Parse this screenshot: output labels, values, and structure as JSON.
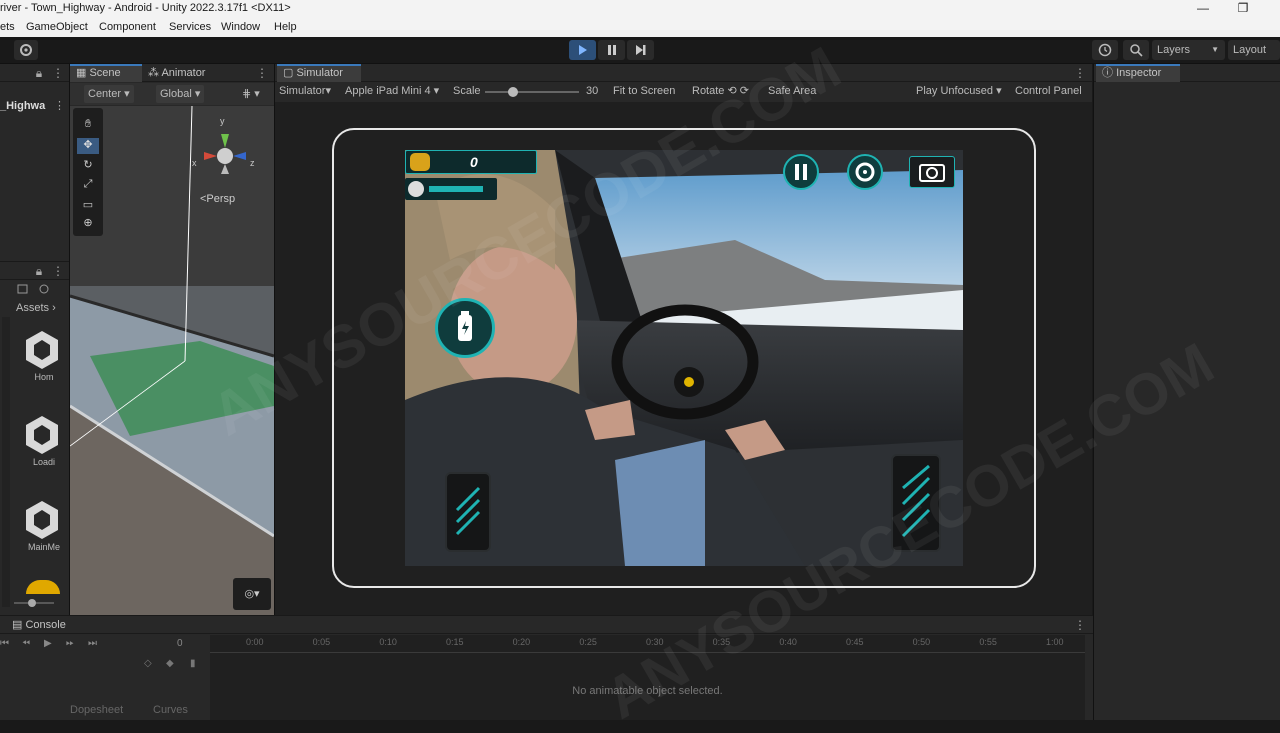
{
  "window": {
    "title": "river - Town_Highway - Android - Unity 2022.3.17f1 <DX11>",
    "minimize_glyph": "—",
    "maximize_glyph": "❐"
  },
  "menu": [
    "ets",
    "GameObject",
    "Component",
    "Services",
    "Window",
    "Help"
  ],
  "toolbar": {
    "layers_label": "Layers",
    "layout_label": "Layout",
    "icons": [
      "gear-icon",
      "play-icon",
      "pause-icon",
      "step-icon",
      "history-icon",
      "search-icon"
    ]
  },
  "hierarchy": {
    "scene_name": "_Highwa"
  },
  "project": {
    "breadcrumb": "Assets",
    "items": [
      {
        "label": "Hom"
      },
      {
        "label": "Loadi"
      },
      {
        "label": "MainMe"
      }
    ]
  },
  "scene_view": {
    "tabs": [
      "Scene",
      "Animator"
    ],
    "pivot_label": "Center",
    "space_label": "Global",
    "persp_label": "<Persp",
    "gizmo_axes": {
      "y": "y",
      "x": "x",
      "z": "z"
    }
  },
  "simulator": {
    "tab": "Simulator",
    "mode": "Simulator",
    "device": "Apple iPad Mini 4",
    "scale_label": "Scale",
    "scale_value": "30",
    "scale_fraction": 0.3,
    "fit_label": "Fit to Screen",
    "rotate_label": "Rotate",
    "safe_area_label": "Safe Area",
    "play_mode": "Play Unfocused",
    "control_panel": "Control Panel"
  },
  "game_hud": {
    "coins": "0",
    "health_fraction": 0.85,
    "icons": [
      "coin-icon",
      "nitro-icon",
      "pause-game-icon",
      "settings-icon",
      "camera-icon",
      "brake-pedal-icon",
      "gas-pedal-icon"
    ]
  },
  "inspector": {
    "tab": "Inspector"
  },
  "console": {
    "tab": "Console",
    "frame": "0",
    "ticks": [
      "0:00",
      "0:05",
      "0:10",
      "0:15",
      "0:20",
      "0:25",
      "0:30",
      "0:35",
      "0:40",
      "0:45",
      "0:50",
      "0:55",
      "1:00"
    ],
    "empty_message": "No animatable object selected.",
    "bottom_tabs": [
      "Dopesheet",
      "Curves"
    ]
  },
  "watermark": "ANYSOURCECODE.COM",
  "colors": {
    "accent": "#3a79bb",
    "hud_teal": "#1fb3b3",
    "highway_green": "#3e8d57"
  }
}
